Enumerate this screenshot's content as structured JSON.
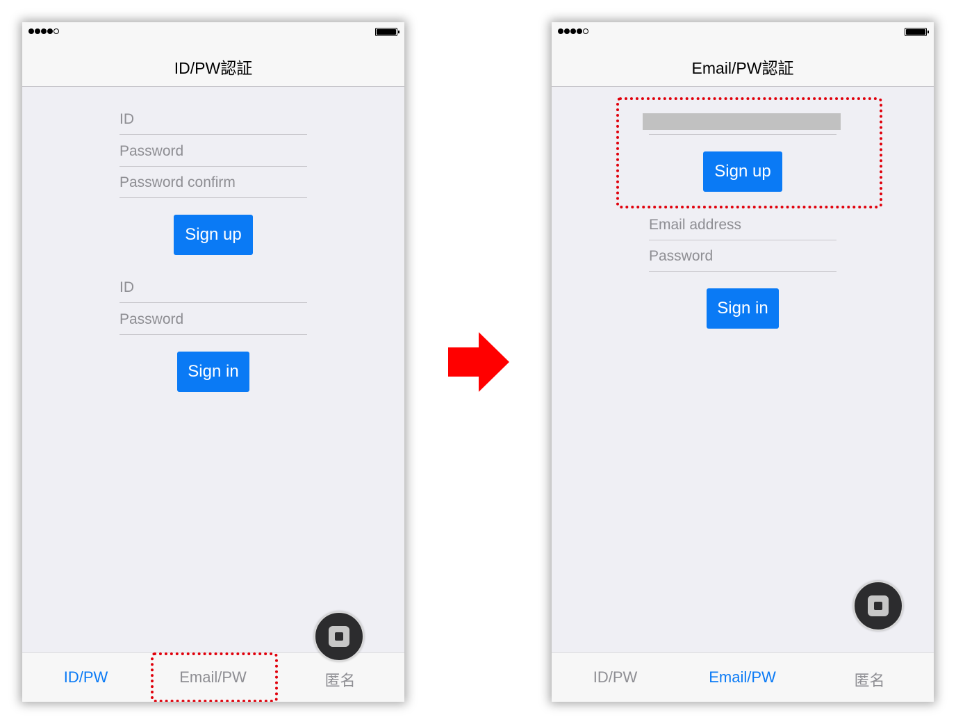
{
  "status_bar": {
    "signal_dots": 5,
    "signal_filled": 4
  },
  "left_screen": {
    "title": "ID/PW認証",
    "signup": {
      "id_placeholder": "ID",
      "password_placeholder": "Password",
      "password_confirm_placeholder": "Password confirm",
      "button": "Sign up"
    },
    "signin": {
      "id_placeholder": "ID",
      "password_placeholder": "Password",
      "button": "Sign in"
    },
    "tabs": [
      {
        "label": "ID/PW",
        "active": true
      },
      {
        "label": "Email/PW",
        "active": false
      },
      {
        "label": "匿名",
        "active": false
      }
    ]
  },
  "right_screen": {
    "title": "Email/PW認証",
    "signup": {
      "button": "Sign up"
    },
    "signin": {
      "email_placeholder": "Email address",
      "password_placeholder": "Password",
      "button": "Sign in"
    },
    "tabs": [
      {
        "label": "ID/PW",
        "active": false
      },
      {
        "label": "Email/PW",
        "active": true
      },
      {
        "label": "匿名",
        "active": false
      }
    ]
  },
  "colors": {
    "accent": "#0a7af5",
    "highlight": "#e0000b",
    "arrow": "#ff0000",
    "background": "#efeff4"
  }
}
